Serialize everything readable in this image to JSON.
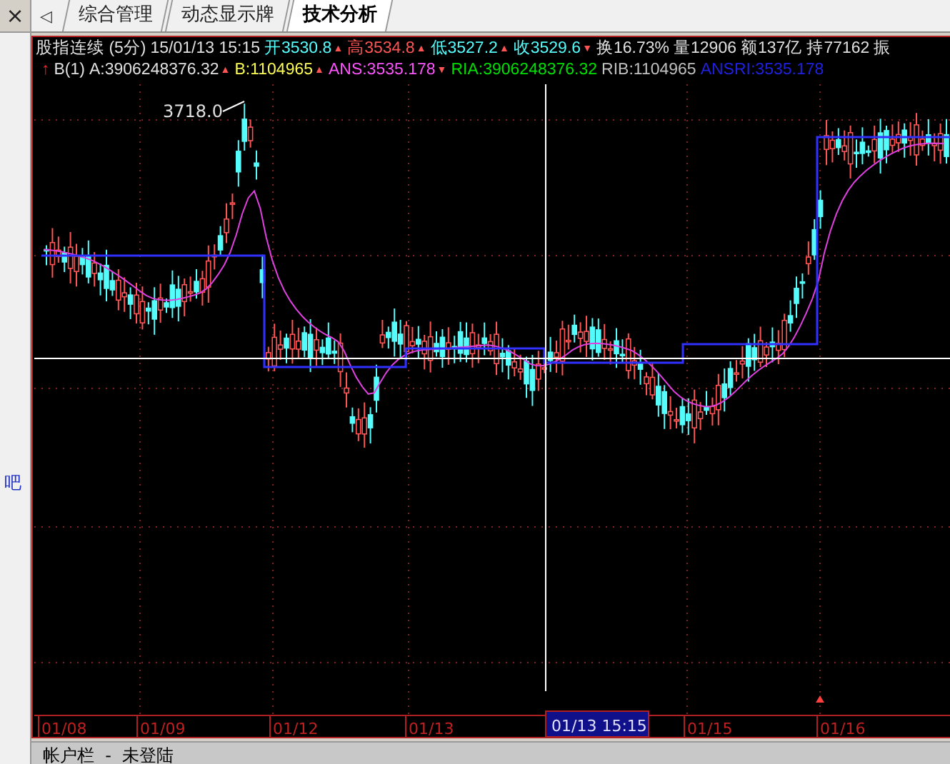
{
  "side_panel": {
    "close": "×",
    "fragment": "吧"
  },
  "tabs": [
    {
      "label": "综合管理",
      "selected": false
    },
    {
      "label": "动态显示牌",
      "selected": false
    },
    {
      "label": "技术分析",
      "selected": true
    }
  ],
  "tab_scroll": "◁",
  "quote_row": [
    {
      "text": "股指连续 (5分)",
      "color": "#e0e0e0"
    },
    {
      "text": "15/01/13 15:15",
      "color": "#e0e0e0"
    },
    {
      "text": "开3530.8",
      "color": "#54fcfc",
      "marker": "▲"
    },
    {
      "text": "高3534.8",
      "color": "#ff5454",
      "marker": "▲"
    },
    {
      "text": "低3527.2",
      "color": "#54fcfc",
      "marker": "▲"
    },
    {
      "text": "收3529.6",
      "color": "#54fcfc",
      "marker": "▼"
    },
    {
      "text": "换16.73%",
      "color": "#e0e0e0"
    },
    {
      "text": "量12906",
      "color": "#e0e0e0"
    },
    {
      "text": "额137亿",
      "color": "#e0e0e0"
    },
    {
      "text": "持77162",
      "color": "#e0e0e0"
    },
    {
      "text": "振",
      "color": "#e0e0e0"
    }
  ],
  "indicator_row": {
    "signal": "↑",
    "name": "B(1)",
    "values": [
      {
        "text": "A:3906248376.32",
        "color": "#e0e0e0",
        "marker": "▲"
      },
      {
        "text": "B:1104965",
        "color": "#fcfc54",
        "marker": "▲"
      },
      {
        "text": "ANS:3535.178",
        "color": "#fc54fc",
        "marker": "▼"
      },
      {
        "text": "RIA:3906248376.32",
        "color": "#00e000"
      },
      {
        "text": "RIB:1104965",
        "color": "#c0c0c0"
      },
      {
        "text": "ANSRI:3535.178",
        "color": "#2020e0"
      }
    ]
  },
  "chart": {
    "peak_label": "3718.0",
    "cursor_label": "01/13 15:15",
    "dates": [
      "01/08",
      "01/09",
      "01/12",
      "01/13",
      "01/15",
      "01/16"
    ]
  },
  "status_bar": {
    "text": "帐户栏  -  未登陆"
  }
}
